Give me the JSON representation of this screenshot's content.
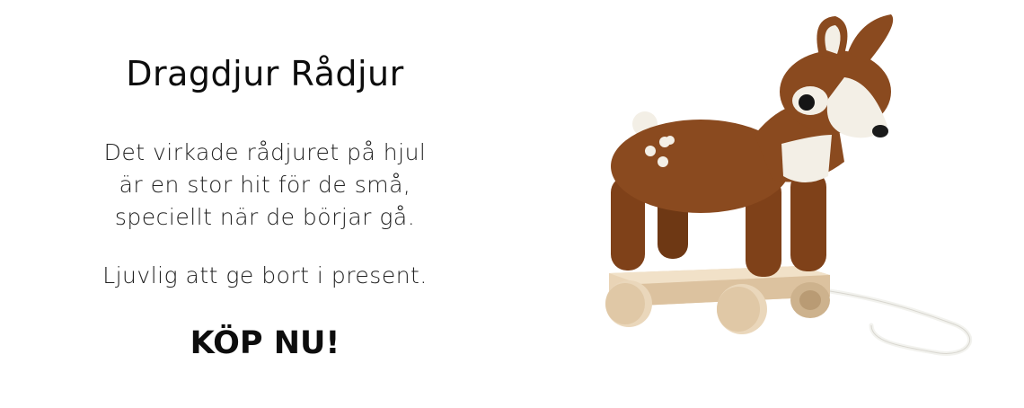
{
  "promo": {
    "title": "Dragdjur Rådjur",
    "description_lines": [
      "Det virkade rådjuret på hjul",
      "är en stor hit för de små,",
      "speciellt när de börjar gå."
    ],
    "gift_text": "Ljuvlig att ge bort i present.",
    "cta_label": "KÖP NU!"
  },
  "image": {
    "subject": "crocheted-deer-pull-toy",
    "colors": {
      "body": "#8a4a1f",
      "white": "#f3efe6",
      "wood": "#e6cfae"
    }
  }
}
